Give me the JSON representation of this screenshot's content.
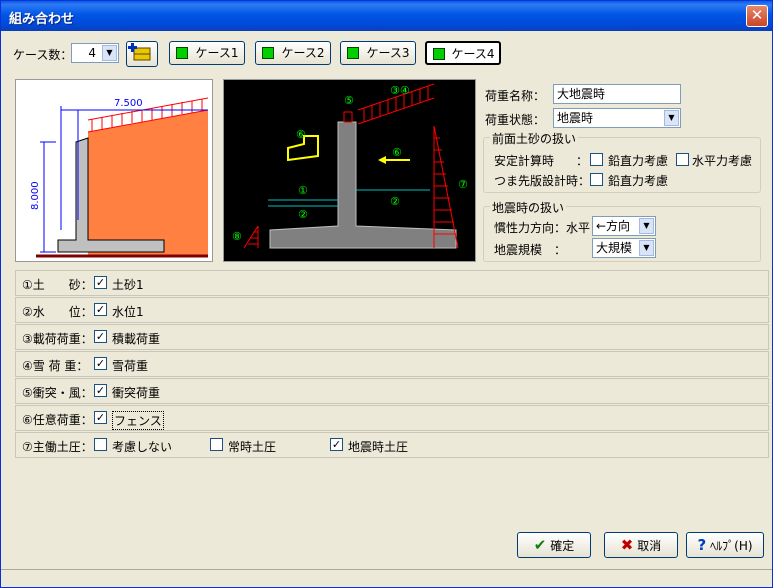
{
  "window": {
    "title": "組み合わせ",
    "close_glyph": "✕"
  },
  "toolbar": {
    "case_count_label": "ケース数：",
    "case_count_value": "4",
    "case_buttons": [
      "ケース1",
      "ケース2",
      "ケース3",
      "ケース4"
    ],
    "active_case": 3
  },
  "diagram_left": {
    "width_label": "7.500",
    "height_label": "8.000"
  },
  "diagram_right": {
    "markers": [
      "①",
      "②",
      "②",
      "③④",
      "⑤",
      "⑥",
      "⑥",
      "⑦",
      "⑧"
    ]
  },
  "props": {
    "load_name_label": "荷重名称：",
    "load_name_value": "大地震時",
    "load_state_label": "荷重状態：",
    "load_state_value": "地震時"
  },
  "front_soil": {
    "title": "前面土砂の扱い",
    "stability_label": "安定計算時",
    "colon": "：",
    "vertical_label": "鉛直力考慮",
    "horizontal_label": "水平力考慮",
    "toe_label": "つま先版設計時：",
    "toe_vertical_label": "鉛直力考慮"
  },
  "seismic": {
    "title": "地震時の扱い",
    "inertia_label": "慣性力方向：水平",
    "inertia_value": "←方向",
    "scale_label": "地震規模　：",
    "scale_value": "大規模"
  },
  "rows": [
    {
      "label": "①土　　砂：",
      "value": "土砂1",
      "checked": true
    },
    {
      "label": "②水　　位：",
      "value": "水位1",
      "checked": true
    },
    {
      "label": "③載荷荷重：",
      "value": "積載荷重",
      "checked": true
    },
    {
      "label": "④雪 荷 重：",
      "value": "雪荷重",
      "checked": true
    },
    {
      "label": "⑤衝突・風：",
      "value": "衝突荷重",
      "checked": true
    },
    {
      "label": "⑥任意荷重：",
      "value": "フェンス",
      "checked": true
    }
  ],
  "active_pressure": {
    "label": "⑦主働土圧：",
    "options": [
      "考慮しない",
      "常時土圧",
      "地震時土圧"
    ],
    "check_mark": "✓"
  },
  "footer": {
    "ok_label": "確定",
    "cancel_label": "取消",
    "help_label": "ﾍﾙﾌﾟ(H)"
  },
  "colors": {
    "soil": "#ff8040",
    "hatch": "#ff0000",
    "concrete": "#c0c0c0",
    "diagram_bg": "#000000",
    "marker": "#00ff00"
  }
}
